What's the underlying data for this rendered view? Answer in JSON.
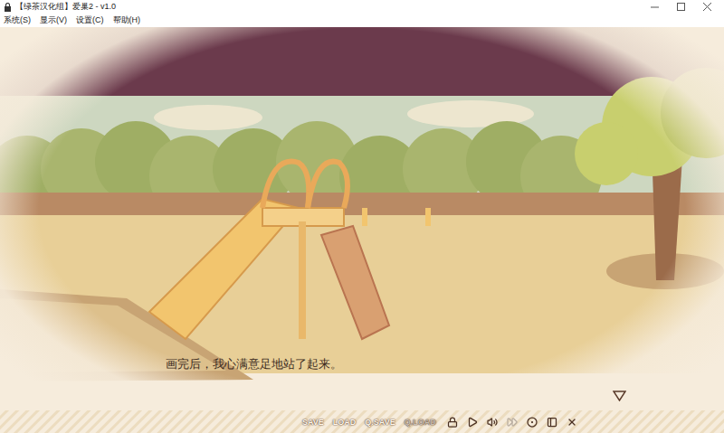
{
  "window": {
    "title": "【绿茶汉化组】爱巢2 - v1.0"
  },
  "menu": [
    {
      "label": "系统(S)"
    },
    {
      "label": "显示(V)"
    },
    {
      "label": "设置(C)"
    },
    {
      "label": "帮助(H)"
    }
  ],
  "dialogue": {
    "text": "画完后，我心满意足地站了起来。"
  },
  "quick_menu": [
    {
      "label": "SAVE",
      "disabled": false
    },
    {
      "label": "LOAD",
      "disabled": false
    },
    {
      "label": "Q.SAVE",
      "disabled": false
    },
    {
      "label": "Q.LOAD",
      "disabled": true
    }
  ],
  "quick_icons": [
    {
      "kind": "lock",
      "disabled": false
    },
    {
      "kind": "play",
      "disabled": false
    },
    {
      "kind": "volume",
      "disabled": false
    },
    {
      "kind": "skip",
      "disabled": true
    },
    {
      "kind": "settings",
      "disabled": false
    },
    {
      "kind": "window",
      "disabled": false
    },
    {
      "kind": "close",
      "disabled": false
    }
  ]
}
